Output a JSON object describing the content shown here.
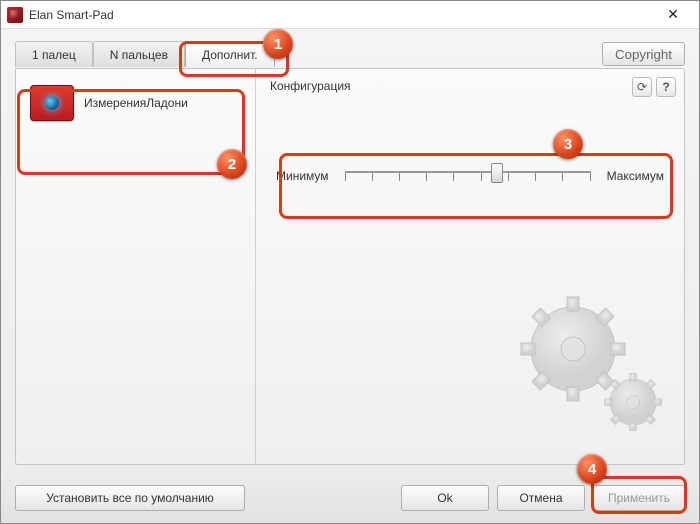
{
  "title": "Elan Smart-Pad",
  "tabs": [
    "1 палец",
    "N пальцев",
    "Дополнит."
  ],
  "active_tab_index": 2,
  "copyright_btn": "Copyright",
  "sidebar": {
    "items": [
      {
        "label": "ИзмеренияЛадони",
        "icon": "touchpad-eye"
      }
    ]
  },
  "main": {
    "section_title": "Конфигурация",
    "refresh_icon": "refresh",
    "help_icon": "?",
    "slider": {
      "min_label": "Минимум",
      "max_label": "Максимум",
      "value_percent": 62
    }
  },
  "footer": {
    "defaults": "Установить все по умолчанию",
    "ok": "Ok",
    "cancel": "Отмена",
    "apply": "Применить",
    "apply_enabled": false
  },
  "callouts": {
    "1": "tab-Дополнит.",
    "2": "sidebar-item",
    "3": "slider",
    "4": "apply-button"
  }
}
